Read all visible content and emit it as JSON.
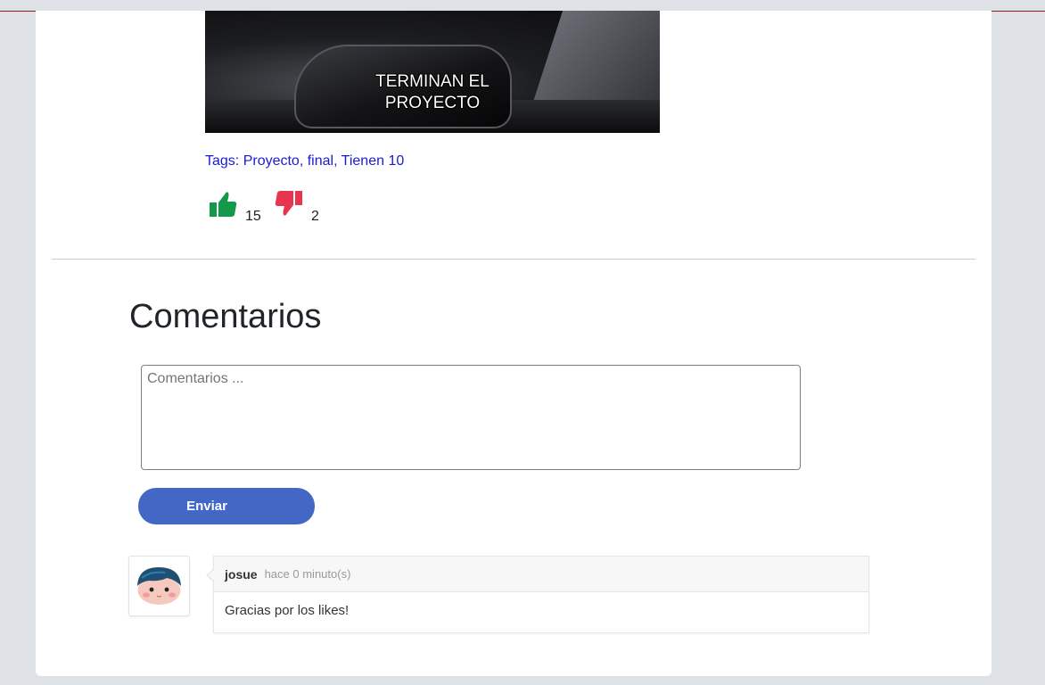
{
  "post": {
    "image_caption_line1": "TERMINAN EL",
    "image_caption_line2": "PROYECTO",
    "tags_text": "Tags: Proyecto, final, Tienen 10",
    "likes": "15",
    "dislikes": "2"
  },
  "comments_section": {
    "title": "Comentarios",
    "input_placeholder": "Comentarios ...",
    "submit_label": "Enviar",
    "items": [
      {
        "user": "josue",
        "time": "hace 0 minuto(s)",
        "text": "Gracias por los likes!"
      }
    ]
  },
  "colors": {
    "like": "#129a4a",
    "dislike": "#e8344e",
    "button": "#4267c4",
    "tags": "#1a1ad4"
  },
  "icons": [
    "thumbs-up-icon",
    "thumbs-down-icon",
    "avatar-face"
  ]
}
